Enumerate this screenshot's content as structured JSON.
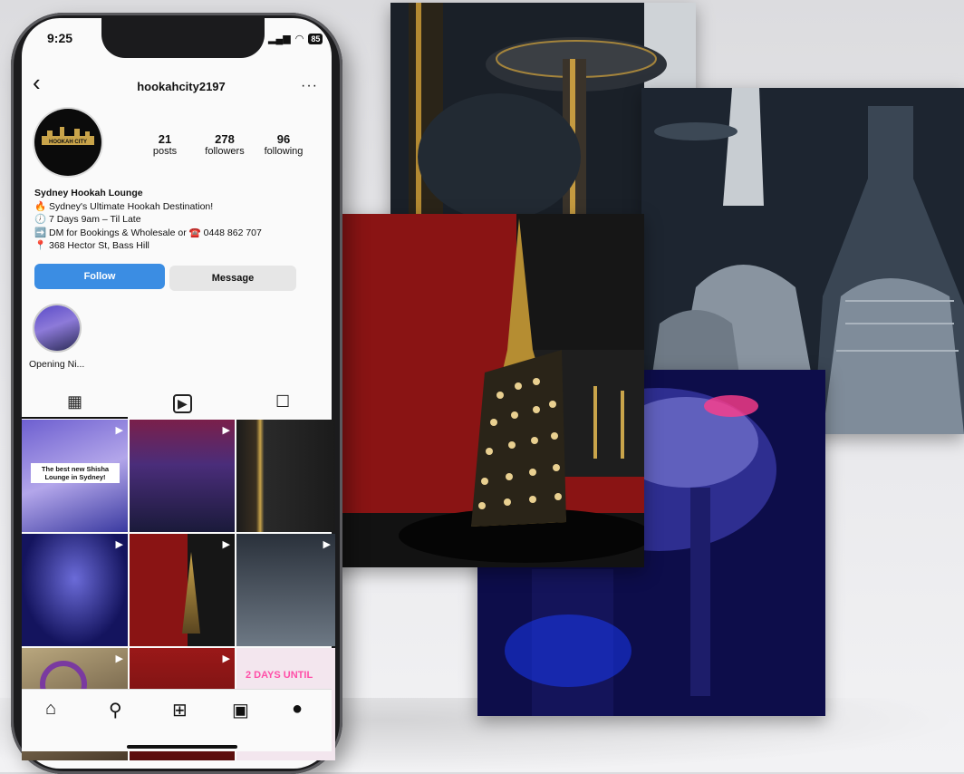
{
  "status_bar": {
    "time": "9:25",
    "battery": "85"
  },
  "profile": {
    "username": "hookahcity2197",
    "avatar_text": "HOOKAH CITY",
    "stats": [
      {
        "value": "21",
        "label": "posts"
      },
      {
        "value": "278",
        "label": "followers"
      },
      {
        "value": "96",
        "label": "following"
      }
    ],
    "bio": {
      "name": "Sydney Hookah Lounge",
      "line1": "🔥 Sydney's Ultimate Hookah Destination!",
      "line2": "🕖 7 Days  9am – Til Late",
      "line3": "➡️ DM for Bookings & Wholesale or ☎️ 0448 862 707",
      "line4": "📍 368 Hector St, Bass Hill"
    },
    "buttons": {
      "follow": "Follow",
      "message": "Message"
    },
    "highlight_label": "Opening Ni..."
  },
  "grid_posts": {
    "post1_caption": "The best new Shisha Lounge in Sydney!",
    "post9_text": "2 DAYS UNTIL"
  },
  "icons": {
    "back": "‹",
    "more": "···",
    "grid": "▦",
    "reels": "▶",
    "tagged": "☐",
    "reel_badge": "▶",
    "home": "⌂",
    "search": "⚲",
    "create": "⊞",
    "reels_nav": "▣",
    "profile": "●"
  },
  "colors": {
    "follow_button": "#3b8de3",
    "accent_red": "#8a1414",
    "gold": "#c9a44a"
  }
}
